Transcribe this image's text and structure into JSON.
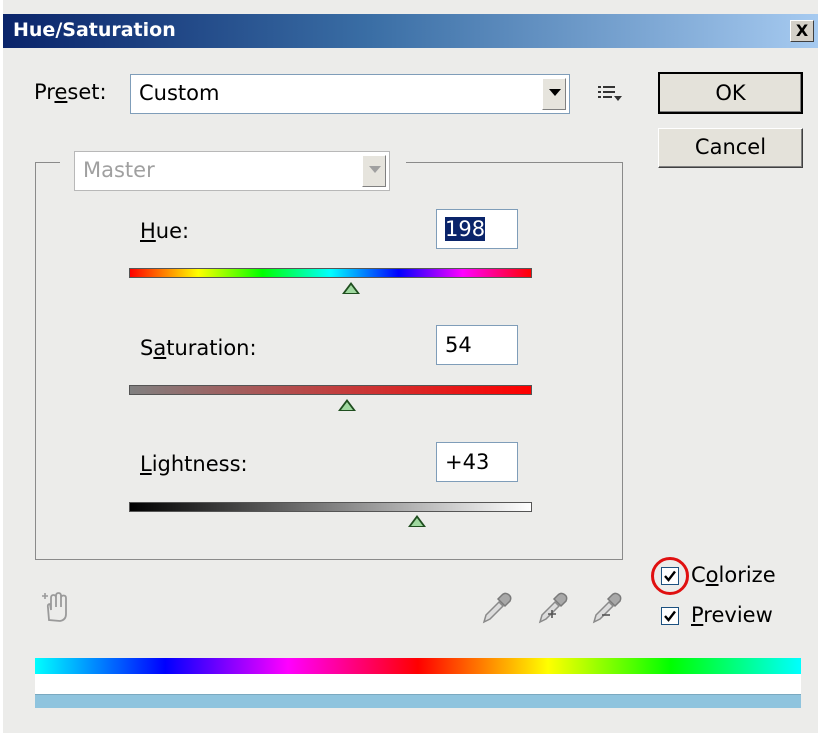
{
  "window": {
    "title": "Hue/Saturation",
    "close_label": "X"
  },
  "preset": {
    "label_pre": "Pr",
    "label_u": "e",
    "label_post": "set:",
    "value": "Custom"
  },
  "buttons": {
    "ok": "OK",
    "cancel": "Cancel"
  },
  "channel": {
    "value": "Master"
  },
  "hue": {
    "label_u": "H",
    "label_rest": "ue:",
    "value": "198",
    "slider_fraction": 0.55
  },
  "saturation": {
    "label_pre": "S",
    "label_u": "a",
    "label_rest": "turation:",
    "value": "54",
    "slider_fraction": 0.54
  },
  "lightness": {
    "label_u": "L",
    "label_rest": "ightness:",
    "value": "+43",
    "slider_fraction": 0.715
  },
  "colorize": {
    "label_pre": "C",
    "label_u": "o",
    "label_rest": "lorize",
    "checked": true,
    "highlight_color": "#e01010"
  },
  "preview": {
    "label_u": "P",
    "label_rest": "review",
    "checked": true
  },
  "colors": {
    "result_bar": "#8fc4de",
    "title_start": "#0a246a",
    "title_end": "#a6caf0"
  },
  "icons": [
    "hand-target-icon",
    "eyedropper-icon",
    "eyedropper-plus-icon",
    "eyedropper-minus-icon",
    "panel-menu-icon",
    "checkmark-icon",
    "close-icon"
  ]
}
